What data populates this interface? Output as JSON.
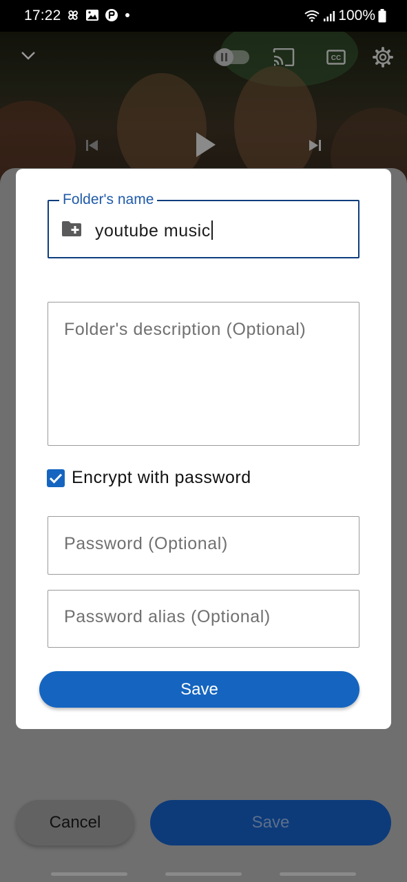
{
  "status_bar": {
    "time": "17:22",
    "battery": "100%"
  },
  "dialog": {
    "folder_name": {
      "label": "Folder's name",
      "value": "youtube music"
    },
    "description": {
      "placeholder": "Folder's description (Optional)"
    },
    "encrypt": {
      "label": "Encrypt with password",
      "checked": true
    },
    "password": {
      "placeholder": "Password (Optional)"
    },
    "password_alias": {
      "placeholder": "Password alias (Optional)"
    },
    "save_label": "Save"
  },
  "background_sheet": {
    "cancel_label": "Cancel",
    "save_label": "Save"
  },
  "colors": {
    "accent": "#1565c0",
    "focus_border": "#0b3d7c",
    "label_blue": "#1f5aa8"
  },
  "icons": [
    "folder-add-icon",
    "checkbox-checked-icon",
    "chevron-down-icon",
    "pause-icon",
    "cast-icon",
    "closed-captions-icon",
    "settings-icon",
    "previous-icon",
    "play-icon",
    "next-icon",
    "wifi-icon",
    "signal-icon",
    "battery-icon"
  ]
}
